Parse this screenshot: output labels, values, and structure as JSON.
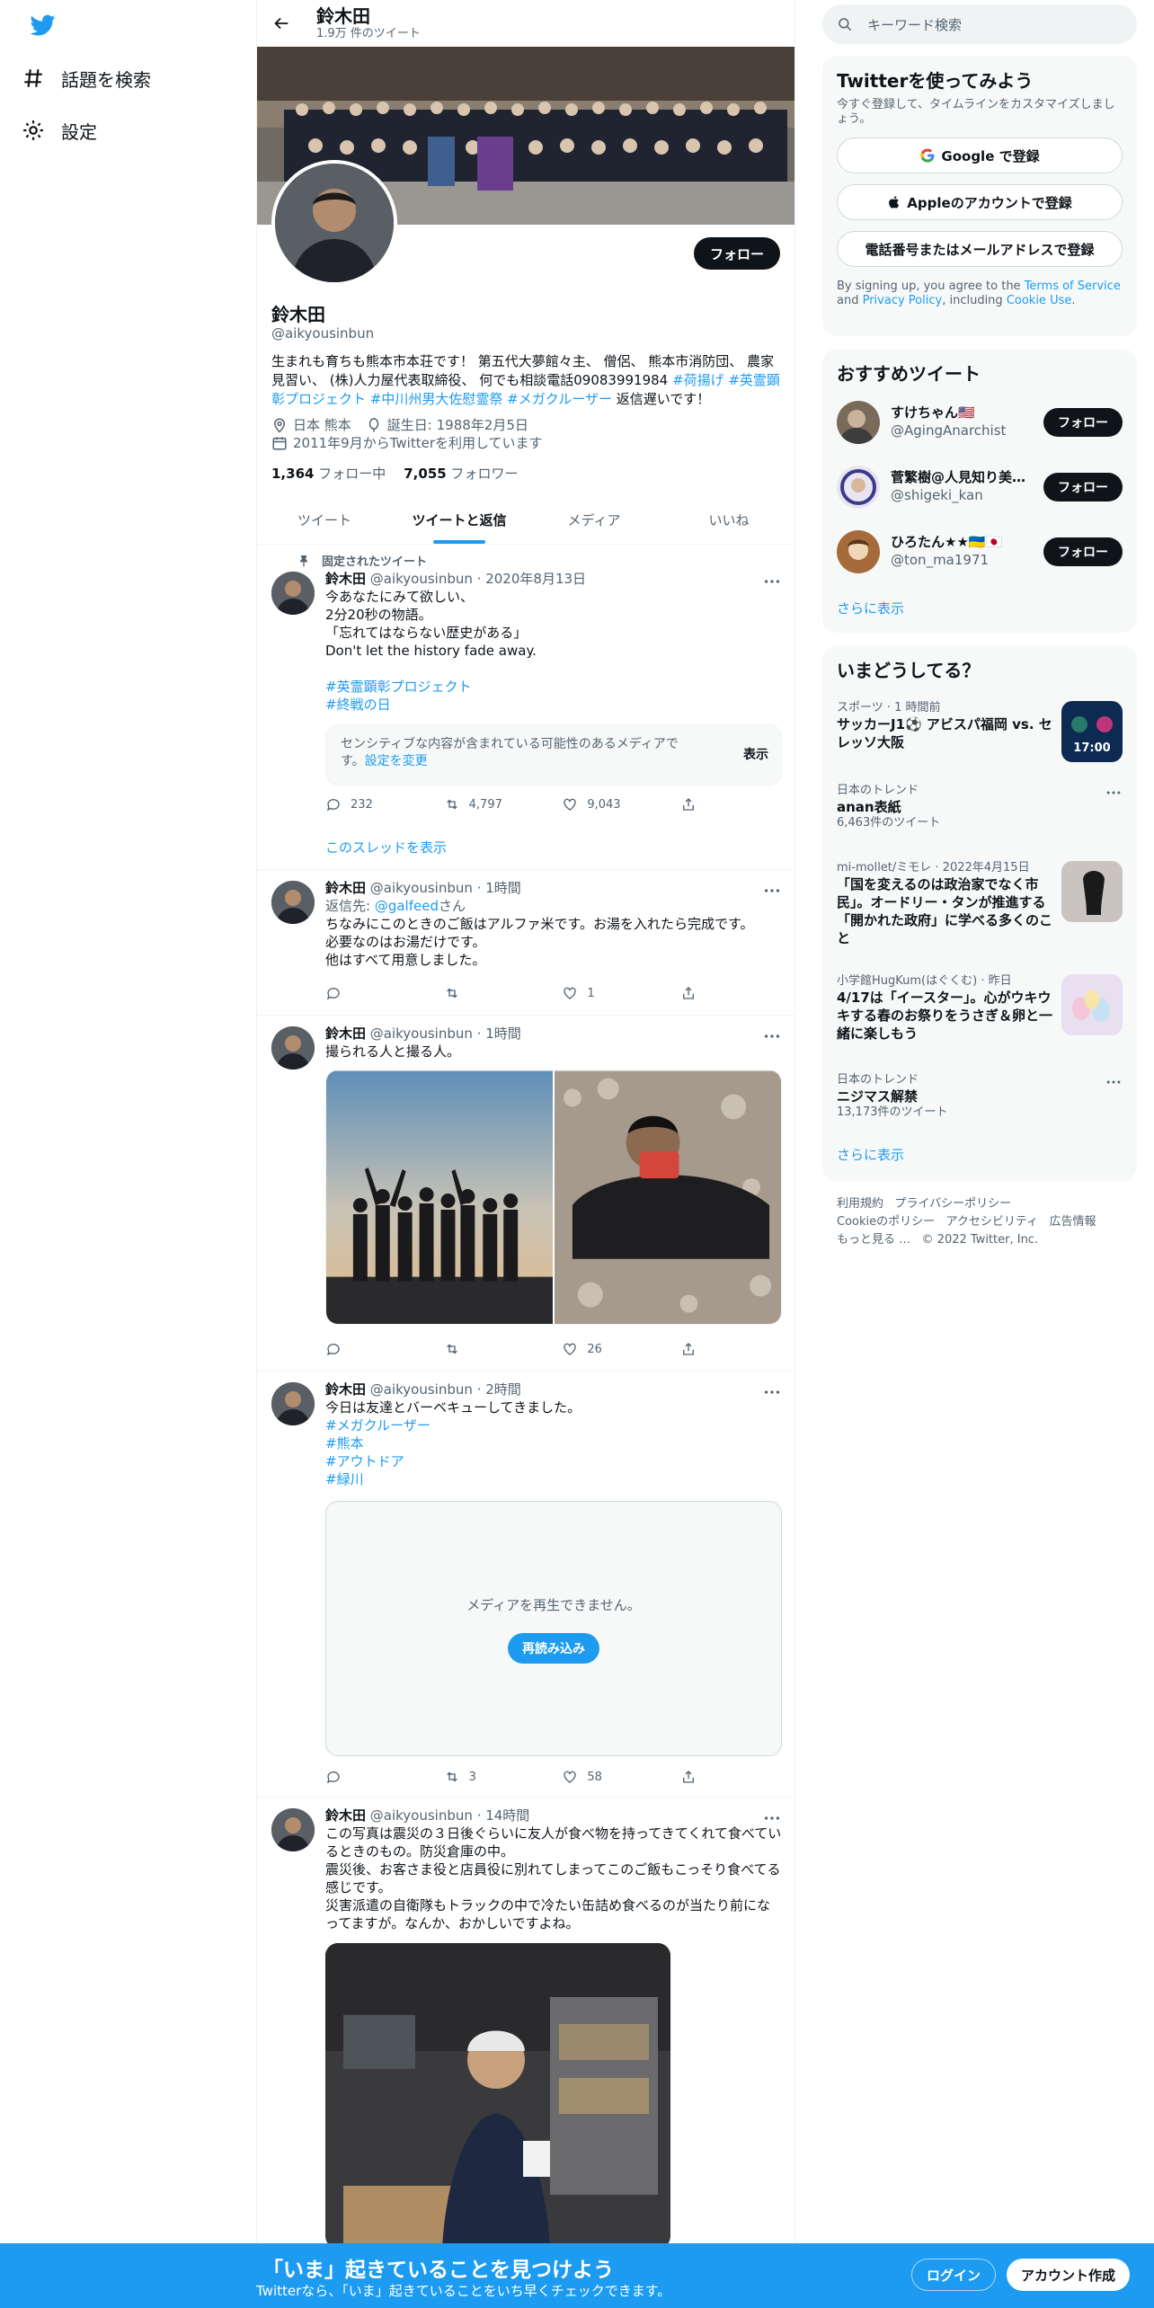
{
  "nav": {
    "explore_label": "話題を検索",
    "settings_label": "設定"
  },
  "header": {
    "name": "鈴木田",
    "tweet_count": "1.9万 件のツイート"
  },
  "profile": {
    "follow_label": "フォロー",
    "name": "鈴木田",
    "handle": "@aikyousinbun",
    "bio_text": "生まれも育ちも熊本市本荘です！ 第五代大夢館々主、 僧侶、 熊本市消防団、 農家見習い、 (株)人力屋代表取締役、 何でも相談電話09083991984 ",
    "bio_tags": [
      "#荷揚げ",
      "#英霊顕彰プロジェクト",
      "#中川州男大佐慰霊祭",
      "#メガクルーザー"
    ],
    "bio_tail": " 返信遅いです！",
    "location": "日本 熊本",
    "birthday": "誕生日: 1988年2月5日",
    "joined": "2011年9月からTwitterを利用しています",
    "following_count": "1,364",
    "following_label": "フォロー中",
    "followers_count": "7,055",
    "followers_label": "フォロワー"
  },
  "tabs": [
    "ツイート",
    "ツイートと返信",
    "メディア",
    "いいね"
  ],
  "tweets": [
    {
      "pinned_label": "固定されたツイート",
      "name": "鈴木田",
      "handle": "@aikyousinbun",
      "time": "· 2020年8月13日",
      "text": "今あなたにみて欲しい、\n2分20秒の物語。\n「忘れてはならない歴史がある」\nDon't let the history fade away.",
      "tags": [
        "#英霊顕彰プロジェクト",
        "#終戦の日"
      ],
      "sensitive_text": "センシティブな内容が含まれている可能性のあるメディアです。",
      "sensitive_link": "設定を変更",
      "sensitive_button": "表示",
      "replies": "232",
      "retweets": "4,797",
      "likes": "9,043",
      "thread_link": "このスレッドを表示"
    },
    {
      "name": "鈴木田",
      "handle": "@aikyousinbun",
      "time": "· 1時間",
      "reply_prefix": "返信先: ",
      "reply_to": "@galfeed",
      "reply_suffix": "さん",
      "text": "ちなみにこのときのご飯はアルファ米です。お湯を入れたら完成です。\n必要なのはお湯だけです。\n他はすべて用意しました。",
      "replies": "",
      "retweets": "",
      "likes": "1"
    },
    {
      "name": "鈴木田",
      "handle": "@aikyousinbun",
      "time": "· 1時間",
      "text": "撮られる人と撮る人。",
      "replies": "",
      "retweets": "",
      "likes": "26"
    },
    {
      "name": "鈴木田",
      "handle": "@aikyousinbun",
      "time": "· 2時間",
      "text": "今日は友達とバーベキューしてきました。",
      "tags": [
        "#メガクルーザー",
        "#熊本",
        "#アウトドア",
        "#緑川"
      ],
      "media_error": "メディアを再生できません。",
      "reload_label": "再読み込み",
      "replies": "",
      "retweets": "3",
      "likes": "58"
    },
    {
      "name": "鈴木田",
      "handle": "@aikyousinbun",
      "time": "· 14時間",
      "text": "この写真は震災の３日後ぐらいに友人が食べ物を持ってきてくれて食べているときのもの。防災倉庫の中。\n震災後、お客さま役と店員役に別れてしまってこのご飯もこっそり食べてる感じです。\n災害派遣の自衛隊もトラックの中で冷たい缶詰め食べるのが当たり前になってますが。なんか、おかしいですよね。"
    }
  ],
  "right": {
    "search_placeholder": "キーワード検索",
    "signup_title": "Twitterを使ってみよう",
    "signup_sub": "今すぐ登録して、タイムラインをカスタマイズしましょう。",
    "google_label": "Google で登録",
    "apple_label": "Appleのアカウントで登録",
    "phone_label": "電話番号またはメールアドレスで登録",
    "terms_prefix": "By signing up, you agree to the ",
    "terms_link": "Terms of Service",
    "terms_and": " and ",
    "privacy_link": "Privacy Policy",
    "terms_including": ", including ",
    "cookie_link": "Cookie Use",
    "terms_end": ".",
    "rec_title": "おすすめツイート",
    "recs": [
      {
        "name": "すけちゃん🇺🇸",
        "handle": "@AgingAnarchist",
        "button": "フォロー"
      },
      {
        "name": "菅繁樹@人見知り美…",
        "handle": "@shigeki_kan",
        "button": "フォロー"
      },
      {
        "name": "ひろたん★★🇺🇦🇯🇵",
        "handle": "@ton_ma1971",
        "button": "フォロー"
      }
    ],
    "show_more": "さらに表示",
    "trends_title": "いまどうしてる？",
    "trends": [
      {
        "category": "スポーツ · 1 時間前",
        "title": "サッカーJ1⚽ アビスパ福岡 vs. セレッソ大阪",
        "thumb_text": "17:00"
      },
      {
        "category": "日本のトレンド",
        "title": "anan表紙",
        "count": "6,463件のツイート"
      },
      {
        "category": "mi-mollet/ミモレ · 2022年4月15日",
        "title": "「国を変えるのは政治家でなく市民」。オードリー・タンが推進する「開かれた政府」に学べる多くのこと"
      },
      {
        "category": "小学館HugKum(はぐくむ) · 昨日",
        "title": "4/17は「イースター」。心がウキウキする春のお祭りをうさぎ＆卵と一緒に楽しもう"
      },
      {
        "category": "日本のトレンド",
        "title": "ニジマス解禁",
        "count": "13,173件のツイート"
      }
    ],
    "show_more2": "さらに表示",
    "footer": {
      "terms": "利用規約",
      "privacy": "プライバシーポリシー",
      "cookie": "Cookieのポリシー",
      "accessibility": "アクセシビリティ",
      "ads": "広告情報",
      "more": "もっと見る …",
      "copyright": "© 2022 Twitter, Inc."
    }
  },
  "bottom": {
    "headline": "「いま」起きていることを見つけよう",
    "sub": "Twitterなら、「いま」起きていることをいち早くチェックできます。",
    "login": "ログイン",
    "signup": "アカウント作成"
  },
  "colors": {
    "accent": "#1d9bf0",
    "text": "#0f1419",
    "muted": "#536471",
    "border": "#eff3f4"
  }
}
